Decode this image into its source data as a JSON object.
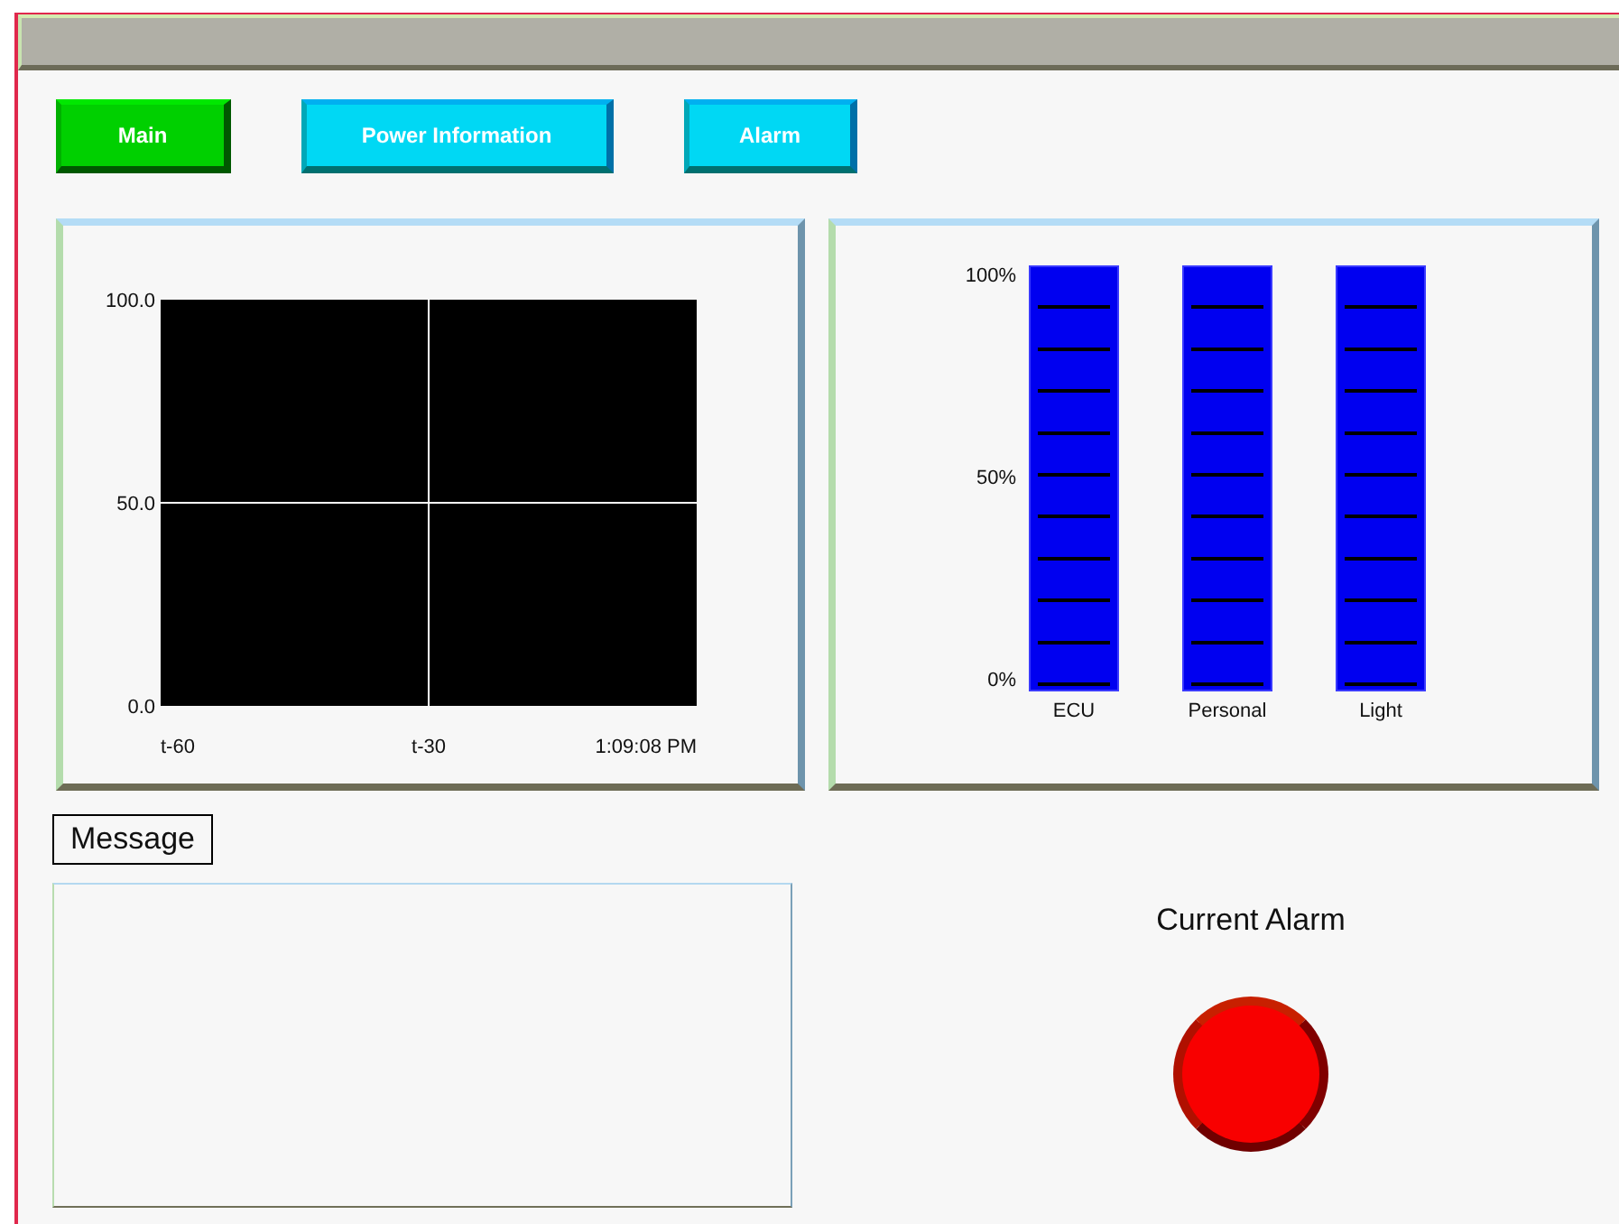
{
  "nav_buttons": [
    {
      "label": "Main",
      "selected": true
    },
    {
      "label": "Power Information",
      "selected": false
    },
    {
      "label": "Alarm",
      "selected": false
    }
  ],
  "trend_chart": {
    "chart_data": {
      "type": "line",
      "ylim": [
        0,
        100
      ],
      "yticks": [
        {
          "value": 100,
          "label": "100.0"
        },
        {
          "value": 50,
          "label": "50.0"
        },
        {
          "value": 0,
          "label": "0.0"
        }
      ],
      "categories": [
        "t-60",
        "t-30",
        "1:09:08 PM"
      ]
    }
  },
  "bar_gauges": {
    "scale_labels": [
      "100%",
      "50%",
      "0%"
    ],
    "gauges": [
      {
        "label": "ECU",
        "level": 1
      },
      {
        "label": "Personal",
        "level": 1
      },
      {
        "label": "Light",
        "level": 1
      }
    ]
  },
  "message": {
    "label": "Message"
  },
  "current_alarm": {
    "label": "Current Alarm",
    "on": true
  }
}
